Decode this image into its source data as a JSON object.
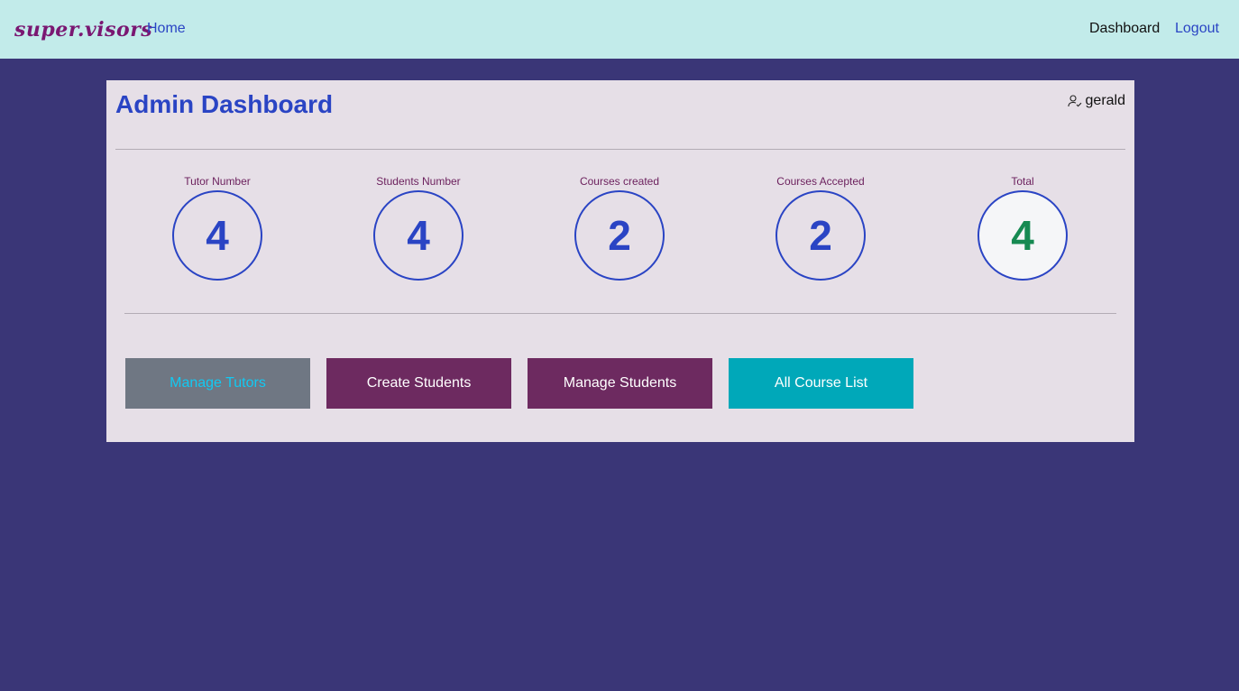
{
  "navbar": {
    "brand": "super.visors",
    "home_label": "Home",
    "dashboard_label": "Dashboard",
    "logout_label": "Logout"
  },
  "main": {
    "title": "Admin Dashboard",
    "user": {
      "icon": "user-check-icon",
      "name": "gerald"
    },
    "stats": [
      {
        "label": "Tutor Number",
        "value": "4"
      },
      {
        "label": "Students Number",
        "value": "4"
      },
      {
        "label": "Courses created",
        "value": "2"
      },
      {
        "label": "Courses Accepted",
        "value": "2"
      },
      {
        "label": "Total",
        "value": "4"
      }
    ],
    "actions": {
      "manage_tutors": "Manage Tutors",
      "create_students": "Create Students",
      "manage_students": "Manage Students",
      "all_course_list": "All Course List"
    }
  },
  "colors": {
    "navbar_bg": "#c2ebea",
    "page_bg": "#3a3677",
    "card_bg": "#e6dfe7",
    "accent_blue": "#2a44c4",
    "brand": "#7a1772",
    "total_green": "#168a52",
    "button_gray": "#6f7783",
    "button_purple": "#6d2a60",
    "button_teal": "#00a8b9"
  }
}
